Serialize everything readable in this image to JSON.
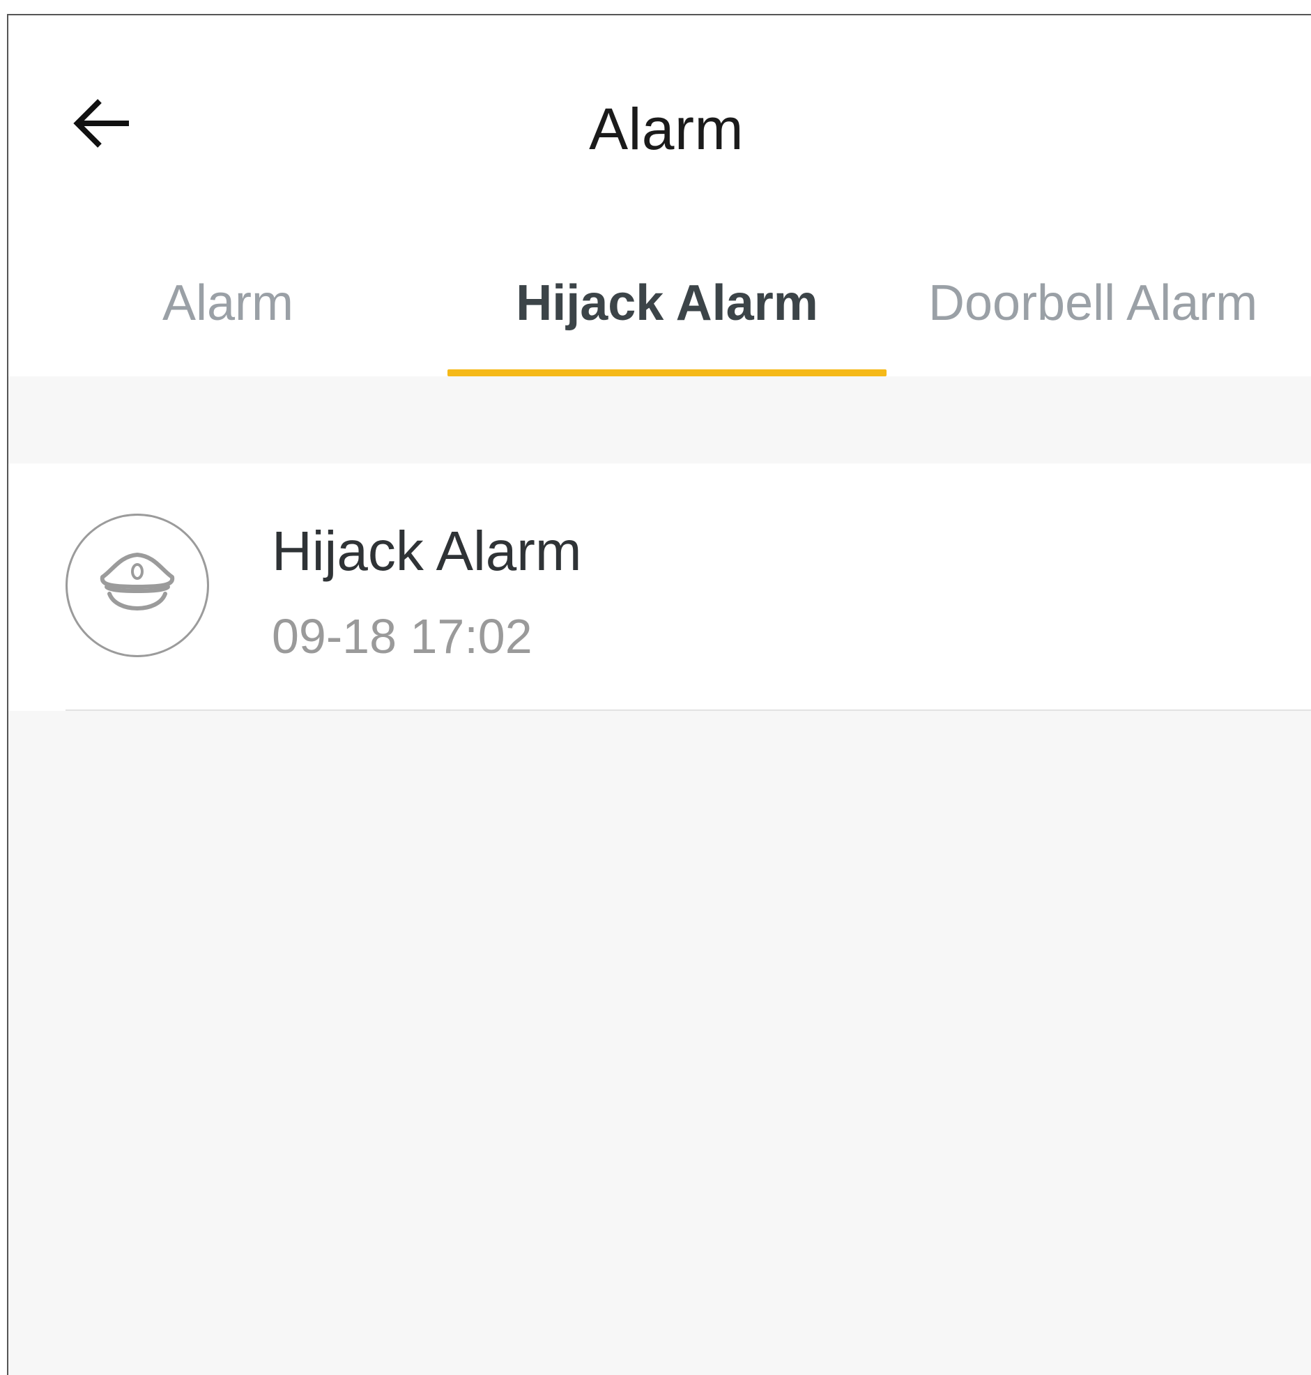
{
  "header": {
    "title": "Alarm",
    "back_icon": "arrow-left-icon"
  },
  "tabs": [
    {
      "label": "Alarm",
      "active": false
    },
    {
      "label": "Hijack Alarm",
      "active": true
    },
    {
      "label": "Doorbell Alarm",
      "active": false
    }
  ],
  "colors": {
    "accent": "#f5b918",
    "active_tab_text": "#3c4448",
    "inactive_tab_text": "#9aa0a6",
    "background": "#f7f7f7"
  },
  "alarms": [
    {
      "icon": "police-cap-icon",
      "title": "Hijack Alarm",
      "time": "09-18 17:02"
    }
  ]
}
